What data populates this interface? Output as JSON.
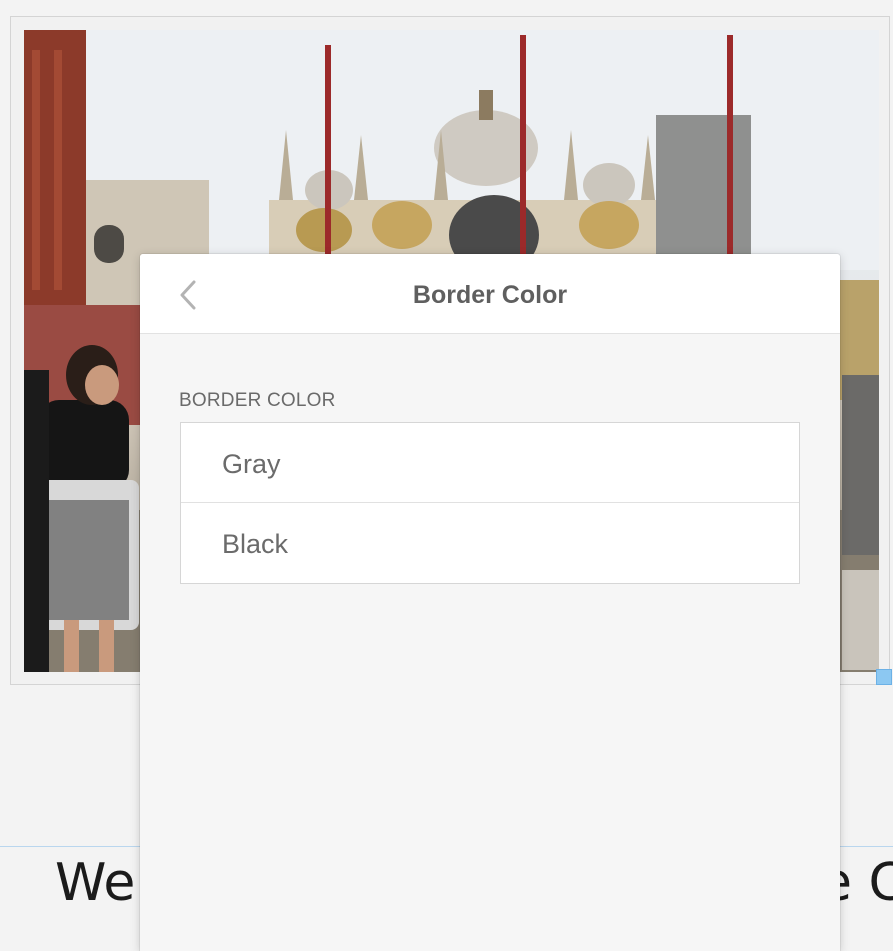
{
  "panel": {
    "title": "Border Color",
    "back_icon": "chevron-left-icon",
    "section_label": "BORDER COLOR",
    "options": [
      {
        "label": "Gray"
      },
      {
        "label": "Black"
      }
    ]
  },
  "page": {
    "heading_left": "We",
    "heading_right": "e C"
  },
  "colors": {
    "panel_background": "#f6f6f6",
    "header_background": "#ffffff",
    "option_text": "#6b6b6b",
    "handle_blue": "#8cc8f2"
  }
}
